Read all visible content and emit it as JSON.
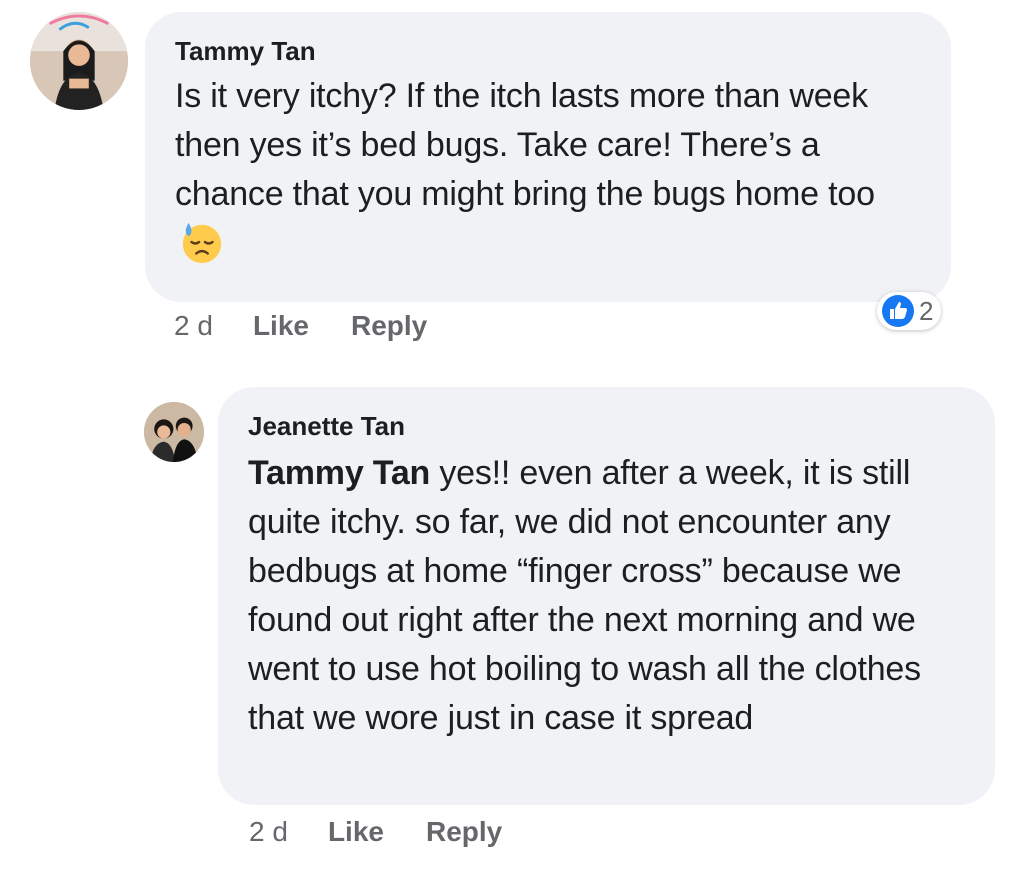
{
  "comment": {
    "author": "Tammy Tan",
    "text": "Is it very itchy? If the itch lasts more than week then yes it’s bed bugs. Take care! There’s a chance that you might bring the bugs home too",
    "emoji": "downcast-face-with-sweat-emoji",
    "time": "2 d",
    "like_label": "Like",
    "reply_label": "Reply",
    "reaction_count": "2",
    "reaction_icon": "like-icon",
    "accent_color": "#1877f2"
  },
  "reply": {
    "author": "Jeanette Tan",
    "mention": "Tammy Tan",
    "text": " yes!! even after a week, it is still quite itchy. so far, we did not encounter any bedbugs at home “finger cross” because we found out right after the next morning and we went to use hot boiling to wash all the clothes that we wore just in case it spread",
    "time": "2 d",
    "like_label": "Like",
    "reply_label": "Reply"
  }
}
